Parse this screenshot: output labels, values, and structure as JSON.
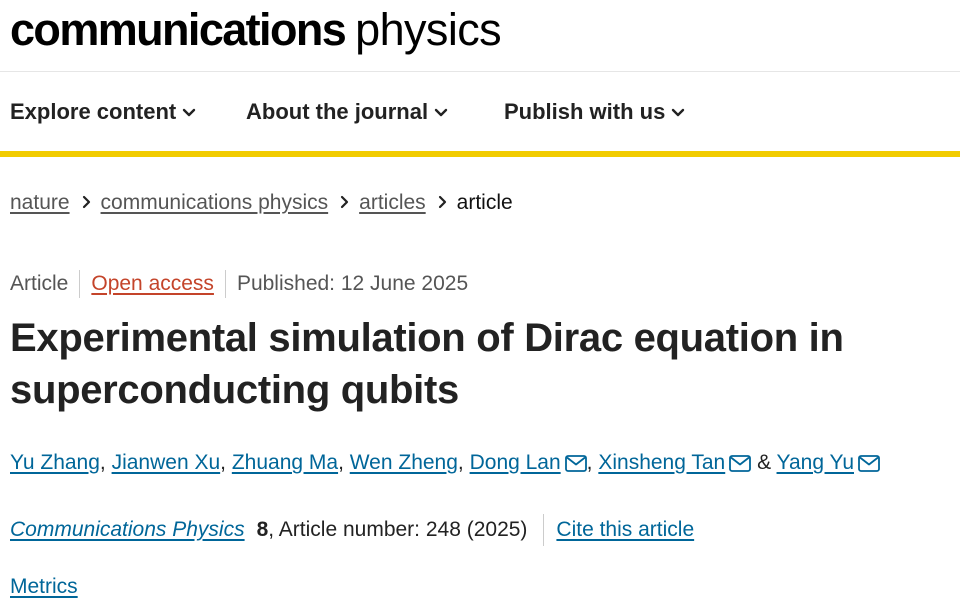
{
  "header": {
    "logo_bold": "communications",
    "logo_light": "physics"
  },
  "nav": {
    "items": [
      {
        "label": "Explore content",
        "icon": "chevron-down-icon"
      },
      {
        "label": "About the journal",
        "icon": "chevron-down-icon"
      },
      {
        "label": "Publish with us",
        "icon": "chevron-down-icon"
      }
    ]
  },
  "colors": {
    "accent_bar": "#f2cc00",
    "link": "#006699",
    "open_access": "#c4442a"
  },
  "breadcrumb": {
    "items": [
      "nature",
      "communications physics",
      "articles",
      "article"
    ]
  },
  "article": {
    "type": "Article",
    "access": "Open access",
    "published": "Published: 12 June 2025",
    "title": "Experimental simulation of Dirac equation in superconducting qubits",
    "authors": [
      {
        "name": "Yu Zhang",
        "sep": ", "
      },
      {
        "name": "Jianwen Xu",
        "sep": ", "
      },
      {
        "name": "Zhuang Ma",
        "sep": ", "
      },
      {
        "name": "Wen Zheng",
        "sep": ", "
      },
      {
        "name": "Dong Lan",
        "sep": ", "
      },
      {
        "name": "Xinsheng Tan",
        "sep": " & "
      },
      {
        "name": "Yang Yu",
        "sep": ""
      }
    ],
    "citation": {
      "journal": "Communications Physics",
      "volume": "8",
      "article_number": ", Article number: 248 (2025)",
      "cite_label": "Cite this article"
    },
    "metrics_label": "Metrics"
  }
}
